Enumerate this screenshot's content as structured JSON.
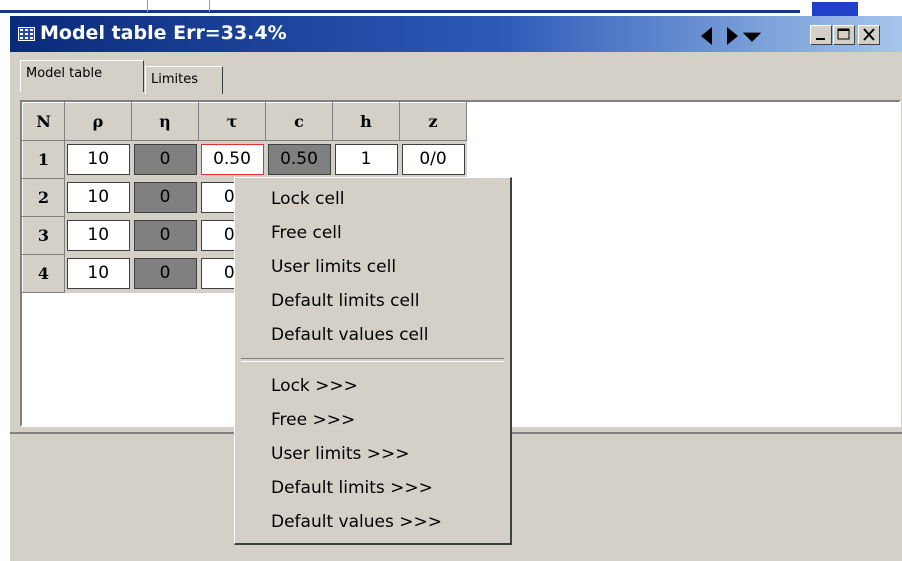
{
  "window": {
    "title": "Model table Err=33.4%",
    "icons": {
      "app": "table-icon",
      "prev": "triangle-left-icon",
      "next": "triangle-right-icon",
      "dropdown": "triangle-down-icon",
      "minimize": "minimize-icon",
      "maximize": "maximize-icon",
      "close": "close-icon"
    }
  },
  "tabs": [
    {
      "label": "Model table",
      "active": true
    },
    {
      "label": "Limites",
      "active": false
    }
  ],
  "table": {
    "headers": [
      "N",
      "ρ",
      "η",
      "τ",
      "c",
      "h",
      "z"
    ],
    "rows": [
      {
        "n": "1",
        "cells": [
          "10",
          "0",
          "0.50",
          "0.50",
          "1",
          "0/0"
        ]
      },
      {
        "n": "2",
        "cells": [
          "10",
          "0",
          "0.",
          "",
          "",
          ""
        ]
      },
      {
        "n": "3",
        "cells": [
          "10",
          "0",
          "0.",
          "",
          "",
          ""
        ]
      },
      {
        "n": "4",
        "cells": [
          "10",
          "0",
          "0.",
          "",
          "",
          ""
        ]
      }
    ]
  },
  "context_menu": {
    "group1": [
      "Lock cell",
      "Free cell",
      "User limits cell",
      "Default limits cell",
      "Default values cell"
    ],
    "group2": [
      "Lock >>>",
      "Free >>>",
      "User limits >>>",
      "Default limits >>>",
      "Default values >>>"
    ]
  },
  "colors": {
    "title_start": "#0a2a7a",
    "title_end": "#a6c6ec",
    "window_bg": "#d4d0c8",
    "locked_cell": "#808080",
    "selected_border": "#e03030"
  }
}
